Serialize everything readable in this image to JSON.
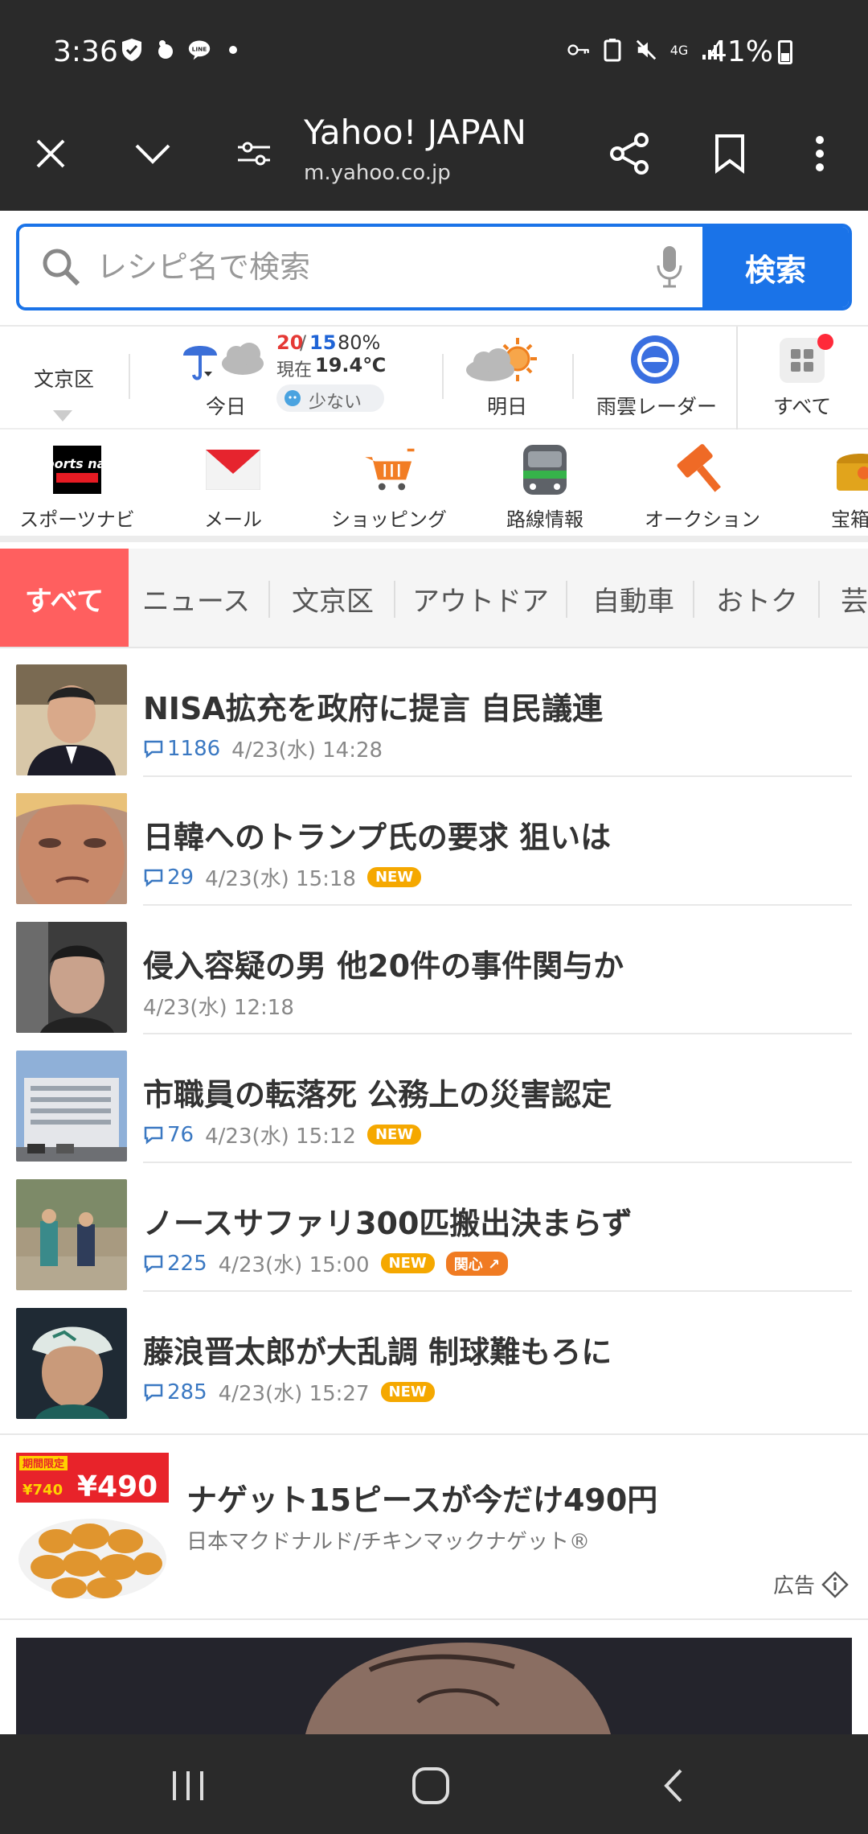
{
  "status_bar": {
    "time": "3:36",
    "network": "4G",
    "battery": "41%"
  },
  "browser": {
    "title": "Yahoo! JAPAN",
    "url": "m.yahoo.co.jp"
  },
  "search": {
    "placeholder": "レシピ名で検索",
    "button_label": "検索"
  },
  "weather": {
    "location": "文京区",
    "today_label": "今日",
    "high": "20",
    "low": "15",
    "precip": "80%",
    "current_prefix": "現在",
    "current_temp": "19.4℃",
    "pollen": "少ない",
    "tomorrow_label": "明日",
    "radar_label": "雨雲レーダー",
    "all_label": "すべて"
  },
  "services": [
    {
      "label": "スポーツナビ",
      "icon": "sportsnavi-icon"
    },
    {
      "label": "メール",
      "icon": "mail-icon"
    },
    {
      "label": "ショッピング",
      "icon": "shopping-cart-icon"
    },
    {
      "label": "路線情報",
      "icon": "train-icon"
    },
    {
      "label": "オークション",
      "icon": "auction-hammer-icon"
    },
    {
      "label": "宝箱く",
      "icon": "treasure-box-icon"
    }
  ],
  "sportsnavi_logo": "Sports navi",
  "tabs": [
    "すべて",
    "ニュース",
    "文京区",
    "アウトドア",
    "自動車",
    "おトク",
    "芸"
  ],
  "news": [
    {
      "headline": "NISA拡充を政府に提言 自民議連",
      "comments": "1186",
      "date": "4/23(水) 14:28",
      "new": "",
      "hot": ""
    },
    {
      "headline": "日韓へのトランプ氏の要求 狙いは",
      "comments": "29",
      "date": "4/23(水) 15:18",
      "new": "NEW",
      "hot": ""
    },
    {
      "headline": "侵入容疑の男 他20件の事件関与か",
      "comments": "",
      "date": "4/23(水) 12:18",
      "new": "",
      "hot": ""
    },
    {
      "headline": "市職員の転落死 公務上の災害認定",
      "comments": "76",
      "date": "4/23(水) 15:12",
      "new": "NEW",
      "hot": ""
    },
    {
      "headline": "ノースサファリ300匹搬出決まらず",
      "comments": "225",
      "date": "4/23(水) 15:00",
      "new": "NEW",
      "hot": "関心"
    },
    {
      "headline": "藤浪晋太郎が大乱調 制球難もろに",
      "comments": "285",
      "date": "4/23(水) 15:27",
      "new": "NEW",
      "hot": ""
    }
  ],
  "ad": {
    "title": "ナゲット15ピースが今だけ490円",
    "sub": "日本マクドナルド/チキンマックナゲット®",
    "label": "広告",
    "promo_tag": "期間限定",
    "old_price": "¥740",
    "price": "¥490"
  },
  "colors": {
    "accent_blue": "#1a73e8",
    "tab_active": "#ff5f5f",
    "new_badge": "#f5a800",
    "toolbar": "#2a2a2a"
  }
}
